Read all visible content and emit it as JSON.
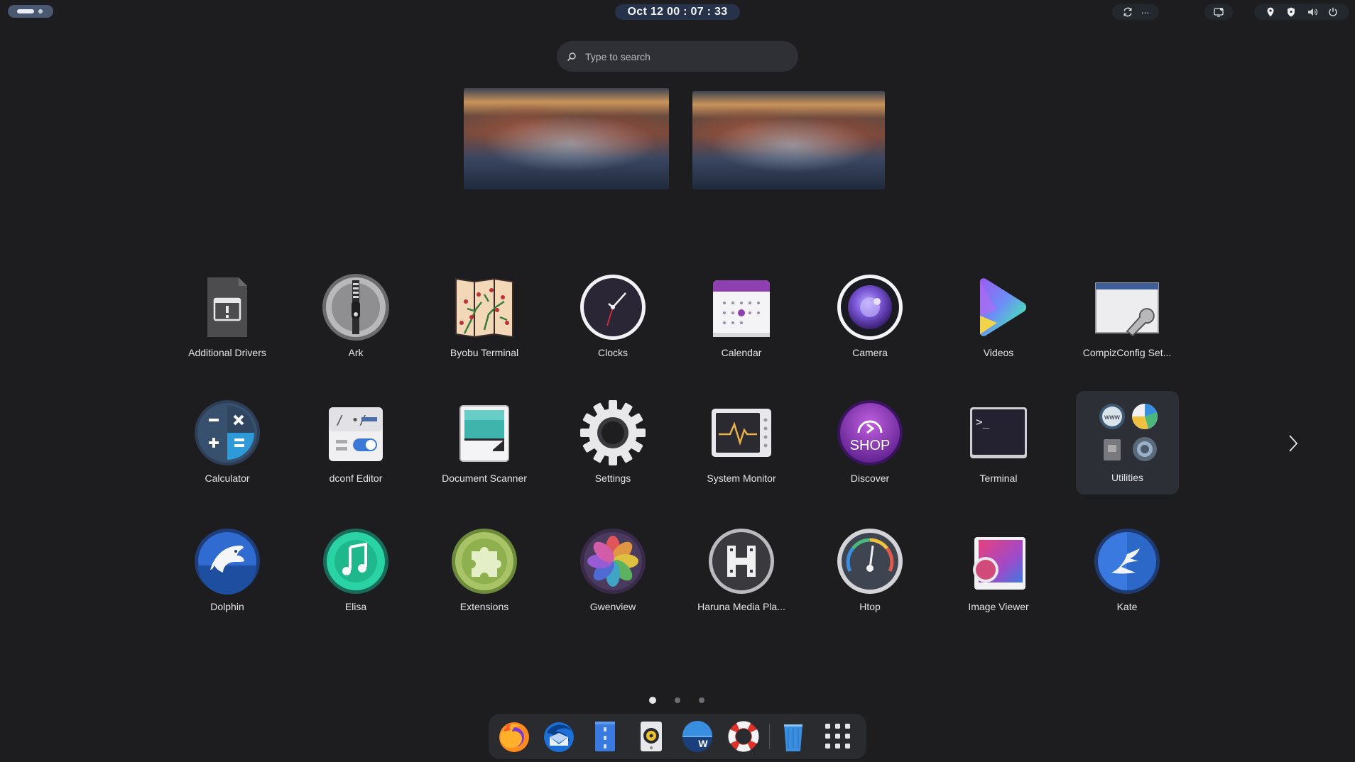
{
  "topbar": {
    "clock": "Oct 12  00 : 07 : 33",
    "tray_more": "..."
  },
  "search": {
    "placeholder": "Type to search"
  },
  "apps": {
    "additional_drivers": "Additional Drivers",
    "ark": "Ark",
    "byobu": "Byobu Terminal",
    "clocks": "Clocks",
    "calendar": "Calendar",
    "camera": "Camera",
    "videos": "Videos",
    "compiz": "CompizConfig Set...",
    "calculator": "Calculator",
    "dconf": "dconf Editor",
    "docscanner": "Document Scanner",
    "settings": "Settings",
    "sysmonitor": "System Monitor",
    "discover": "Discover",
    "terminal": "Terminal",
    "utilities": "Utilities",
    "dolphin": "Dolphin",
    "elisa": "Elisa",
    "extensions": "Extensions",
    "gwenview": "Gwenview",
    "haruna": "Haruna Media Pla...",
    "htop": "Htop",
    "imageviewer": "Image Viewer",
    "kate": "Kate"
  },
  "icon_text": {
    "discover_shop": "SHOP",
    "terminal_prompt": ">_",
    "utilities_www": "www",
    "dock_writer": "W"
  },
  "pager": {
    "pages": 3,
    "active": 1
  },
  "dock": [
    "firefox-icon",
    "thunderbird-icon",
    "files-icon",
    "rhythmbox-icon",
    "libreoffice-writer-icon",
    "help-icon",
    "trash-icon",
    "show-apps-icon"
  ],
  "colors": {
    "background": "#1d1d1f",
    "accent": "#4a5872",
    "clock_bg": "#26324a"
  }
}
